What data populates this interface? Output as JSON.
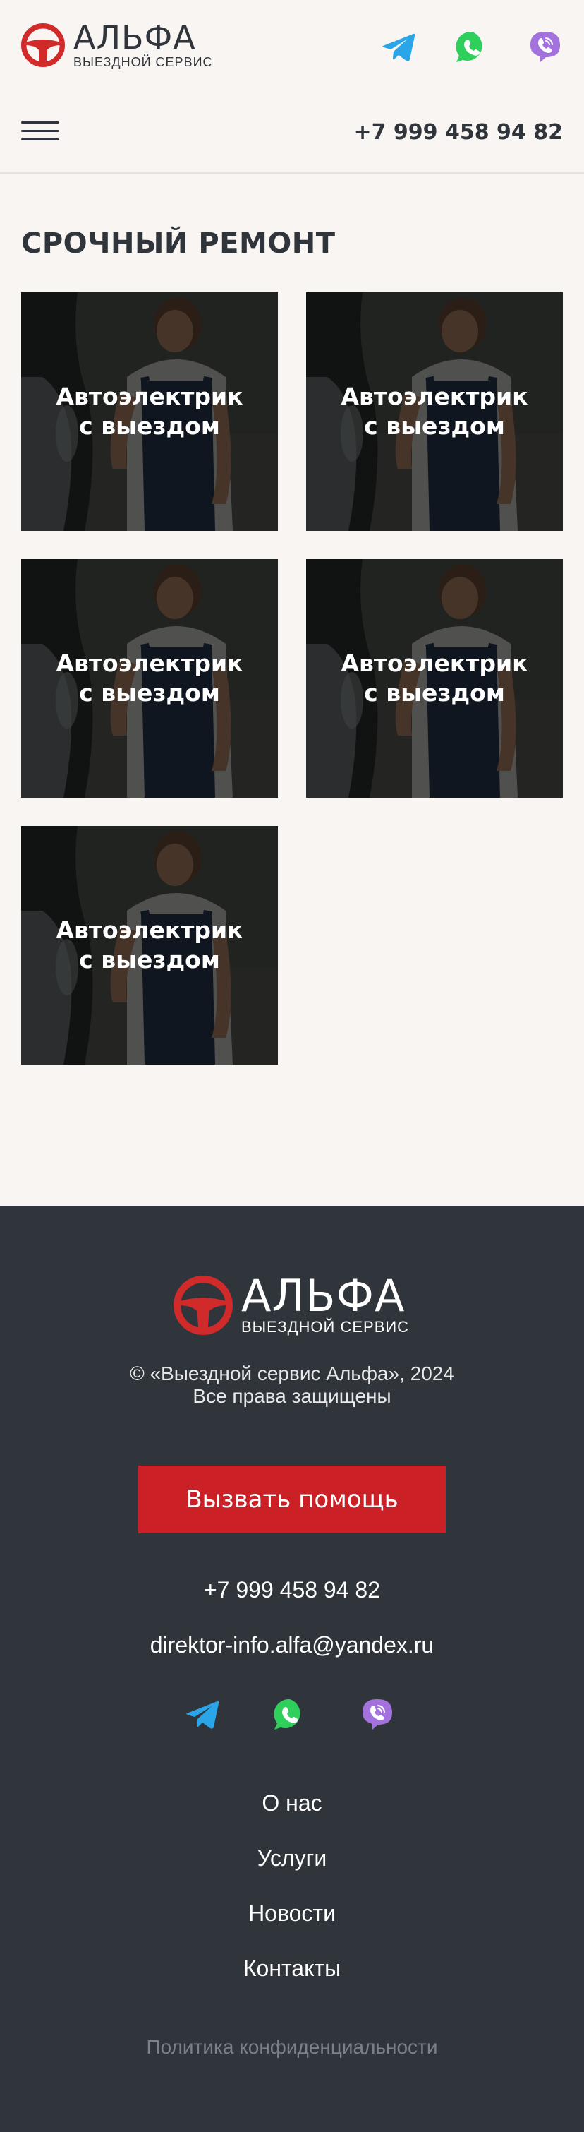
{
  "brand": {
    "name": "АЛЬФА",
    "tagline": "ВЫЕЗДНОЙ СЕРВИС",
    "logo_icon": "steering-wheel-icon",
    "accent_color": "#d12a2a"
  },
  "header": {
    "phone": "+7 999 458 94 82",
    "menu_icon": "hamburger-menu-icon",
    "social": [
      {
        "icon": "telegram-icon",
        "color": "#2aa6e8"
      },
      {
        "icon": "whatsapp-icon",
        "color": "#2ed05b"
      },
      {
        "icon": "viber-icon",
        "color": "#a372dc"
      }
    ]
  },
  "section": {
    "title": "СРОЧНЫЙ РЕМОНТ",
    "cards": [
      {
        "label": "Автоэлектрик\nс выездом"
      },
      {
        "label": "Автоэлектрик\nс выездом"
      },
      {
        "label": "Автоэлектрик\nс выездом"
      },
      {
        "label": "Автоэлектрик\nс выездом"
      },
      {
        "label": "Автоэлектрик\nс выездом"
      }
    ]
  },
  "footer": {
    "copyright_line1": "© «Выездной сервис Альфа», 2024",
    "copyright_line2": "Все права защищены",
    "cta_label": "Вызвать помощь",
    "phone": "+7 999 458 94 82",
    "email": "direktor-info.alfa@yandex.ru",
    "nav": [
      "О нас",
      "Услуги",
      "Новости",
      "Контакты"
    ],
    "privacy": "Политика конфиденциальности",
    "background_color": "#30353c",
    "cta_color": "#cc2027"
  }
}
